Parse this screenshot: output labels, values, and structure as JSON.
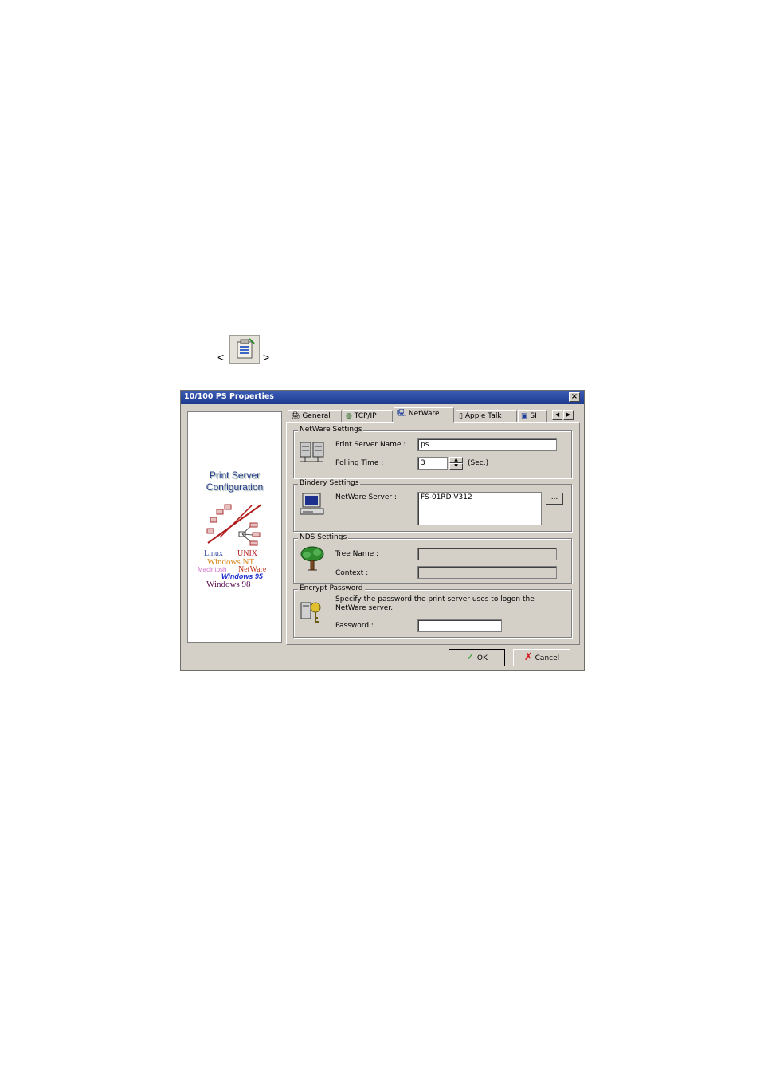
{
  "toolbar_reference": {
    "open": "<",
    "close": ">",
    "icon": "properties-icon"
  },
  "dialog": {
    "title": "10/100 PS Properties",
    "close_label": "×",
    "left_panel": {
      "heading_line1": "Print Server",
      "heading_line2": "Configuration",
      "os_logos": [
        "Linux",
        "UNIX",
        "Windows NT",
        "Macintosh",
        "NetWare",
        "Windows 95",
        "Windows 98"
      ]
    },
    "tabs": [
      {
        "label": "General",
        "icon": "printer-icon"
      },
      {
        "label": "TCP/IP",
        "icon": "globe-icon"
      },
      {
        "label": "NetWare",
        "icon": "computer-icon",
        "active": true
      },
      {
        "label": "Apple Talk",
        "icon": "clipboard-icon"
      },
      {
        "label": "SI",
        "icon": "network-icon"
      }
    ],
    "netware_settings": {
      "legend": "NetWare Settings",
      "print_server_name_label": "Print Server Name :",
      "print_server_name_value": "ps",
      "polling_time_label": "Polling Time :",
      "polling_time_value": "3",
      "polling_time_unit": "(Sec.)"
    },
    "bindery_settings": {
      "legend": "Bindery Settings",
      "netware_server_label": "NetWare Server :",
      "netware_server_value": "FS-01RD-V312",
      "browse_label": "..."
    },
    "nds_settings": {
      "legend": "NDS Settings",
      "tree_name_label": "Tree Name :",
      "context_label": "Context :"
    },
    "encrypt_password": {
      "legend": "Encrypt Password",
      "description_line1": "Specify the password the print server uses to logon the",
      "description_line2": "NetWare server.",
      "password_label": "Password :"
    },
    "buttons": {
      "ok": "OK",
      "cancel": "Cancel"
    },
    "colors": {
      "title_bar": "#1d3a8f",
      "face": "#d4d0c8",
      "ok_check": "#2e9a2e",
      "cancel_x": "#d41b1b"
    }
  }
}
